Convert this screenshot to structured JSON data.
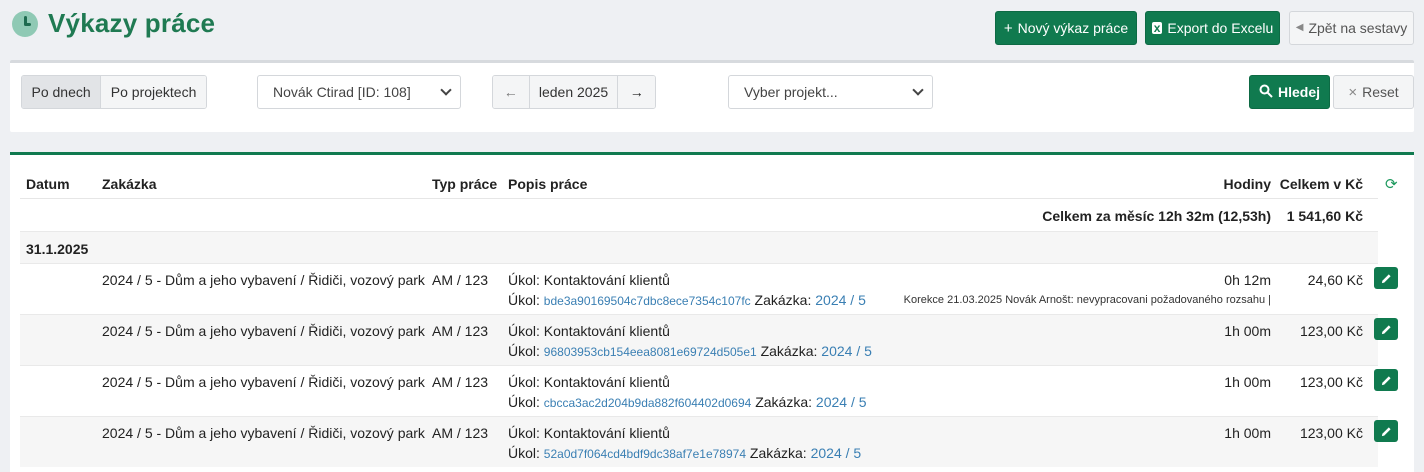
{
  "header": {
    "title": "Výkazy práce",
    "new_label": "Nový výkaz práce",
    "export_label": "Export do Excelu",
    "back_label": "Zpět na sestavy"
  },
  "filters": {
    "tab_days": "Po dnech",
    "tab_projects": "Po projektech",
    "person_selected": "Novák Ctirad [ID: 108]",
    "month": "leden 2025",
    "project_placeholder": "Vyber projekt...",
    "search_label": "Hledej",
    "reset_label": "Reset"
  },
  "table": {
    "columns": {
      "date": "Datum",
      "order": "Zakázka",
      "type": "Typ práce",
      "desc": "Popis práce",
      "hours": "Hodiny",
      "total": "Celkem v Kč"
    },
    "summary_label": "Celkem za měsíc 12h 32m (12,53h)",
    "summary_total": "1 541,60 Kč",
    "day_date": "31.1.2025",
    "task_prefix": "Úkol:",
    "order_prefix": "Zakázka:",
    "rows": [
      {
        "order": "2024 / 5 - Dům a jeho vybavení / Řidiči, vozový park",
        "type": "AM  / 123",
        "task": "Úkol: Kontaktování klientů",
        "hash": "bde3a90169504c7dbc8ece7354c107fc",
        "order_link": "2024 / 5",
        "hours": "0h 12m",
        "note": "Korekce 21.03.2025 Novák Arnošt: nevypracovani požadovaného rozsahu |",
        "total": "24,60 Kč"
      },
      {
        "order": "2024 / 5 - Dům a jeho vybavení / Řidiči, vozový park",
        "type": "AM  / 123",
        "task": "Úkol: Kontaktování klientů",
        "hash": "96803953cb154eea8081e69724d505e1",
        "order_link": "2024 / 5",
        "hours": "1h 00m",
        "note": "",
        "total": "123,00 Kč"
      },
      {
        "order": "2024 / 5 - Dům a jeho vybavení / Řidiči, vozový park",
        "type": "AM  / 123",
        "task": "Úkol: Kontaktování klientů",
        "hash": "cbcca3ac2d204b9da882f604402d0694",
        "order_link": "2024 / 5",
        "hours": "1h 00m",
        "note": "",
        "total": "123,00 Kč"
      },
      {
        "order": "2024 / 5 - Dům a jeho vybavení / Řidiči, vozový park",
        "type": "AM  / 123",
        "task": "Úkol: Kontaktování klientů",
        "hash": "52a0d7f064cd4bdf9dc38af7e1e78974",
        "order_link": "2024 / 5",
        "hours": "1h 00m",
        "note": "",
        "total": "123,00 Kč"
      }
    ]
  },
  "colors": {
    "primary": "#107a4f",
    "title": "#1f7a52",
    "link": "#3a7fb3"
  }
}
